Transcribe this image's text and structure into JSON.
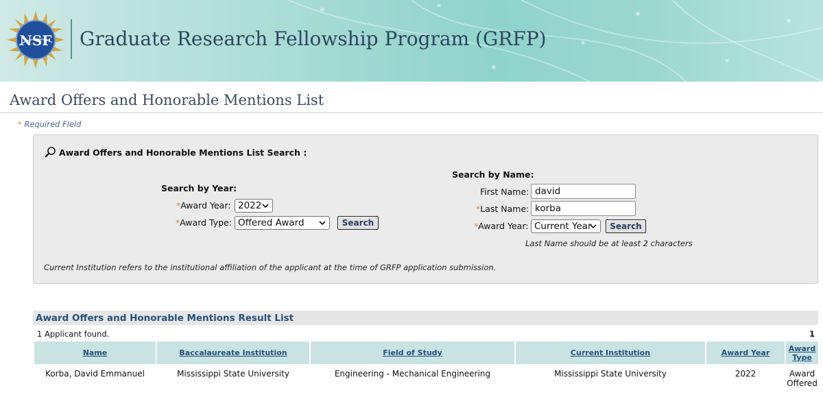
{
  "app": {
    "title": "Graduate Research Fellowship Program (GRFP)",
    "logo_text": "NSF"
  },
  "page": {
    "title": "Award Offers and Honorable Mentions List",
    "required_star": "*",
    "required_label": "Required Field"
  },
  "search": {
    "header": "Award Offers and Honorable Mentions List Search :",
    "by_year": {
      "heading": "Search by Year:",
      "award_year_label": "Award Year:",
      "award_year_value": "2022",
      "award_type_label": "Award Type:",
      "award_type_value": "Offered Award",
      "search_button": "Search"
    },
    "by_name": {
      "heading": "Search by Name:",
      "first_name_label": "First Name:",
      "first_name_value": "david",
      "last_name_label": "Last Name:",
      "last_name_value": "korba",
      "award_year_label": "Award Year:",
      "award_year_value": "Current Year",
      "search_button": "Search",
      "hint": "Last Name should be at least 2 characters"
    },
    "footnote": "Current Institution refers to the institutional affiliation of the applicant at the time of GRFP application submission."
  },
  "results": {
    "header": "Award Offers and Honorable Mentions Result List",
    "count_text": "1 Applicant found.",
    "page_number": "1",
    "columns": {
      "name": "Name",
      "bacc": "Baccalaureate Institution",
      "field": "Field of Study",
      "current": "Current Institution",
      "year": "Award Year",
      "type": "Award Type"
    },
    "rows": [
      {
        "name": "Korba, David Emmanuel",
        "bacc": "Mississippi State University",
        "field": "Engineering - Mechanical Engineering",
        "current": "Mississippi State University",
        "year": "2022",
        "type": "Award Offered"
      }
    ]
  },
  "colors": {
    "banner_teal": "#8fd3cb",
    "title_navy": "#2e4660",
    "link_blue": "#23527c",
    "header_cell": "#c9e2e2",
    "required_star": "#d58a2a"
  },
  "icons": [
    "nsf-logo-icon",
    "magnifier-icon",
    "chevron-down-icon"
  ]
}
